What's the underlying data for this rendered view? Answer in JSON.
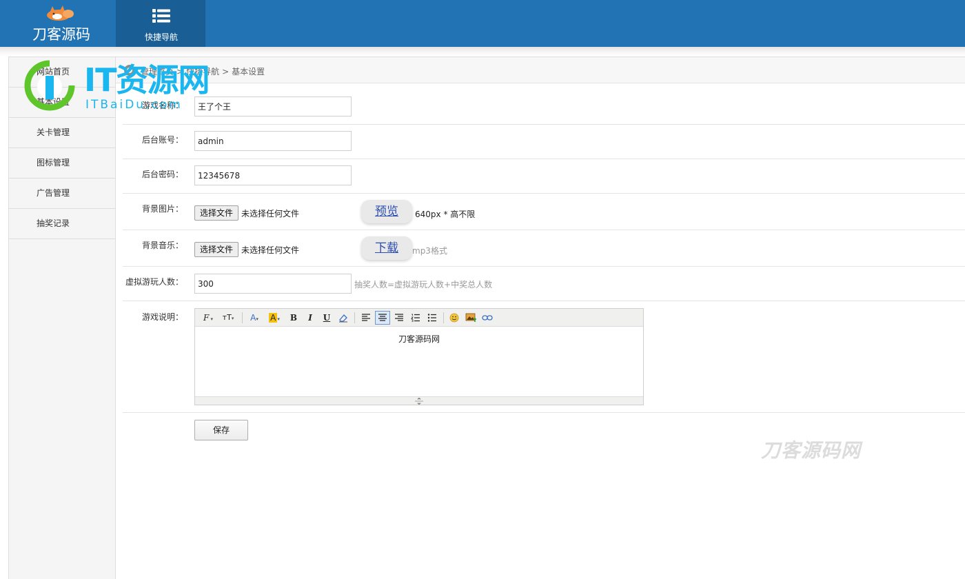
{
  "header": {
    "brand_name": "刀客源码",
    "quick_nav_label": "快捷导航",
    "brand_color": "#2173b3"
  },
  "sidebar": {
    "items": [
      {
        "label": "网站首页"
      },
      {
        "label": "基本设置"
      },
      {
        "label": "关卡管理"
      },
      {
        "label": "图标管理"
      },
      {
        "label": "广告管理"
      },
      {
        "label": "抽奖记录"
      }
    ]
  },
  "breadcrumb": {
    "items": [
      "管理首页",
      ">",
      "快捷导航",
      ">",
      "基本设置"
    ]
  },
  "form": {
    "game_name": {
      "label": "游戏名称：",
      "value": "王了个王"
    },
    "admin_account": {
      "label": "后台账号：",
      "value": "admin"
    },
    "admin_password": {
      "label": "后台密码：",
      "value": "12345678"
    },
    "background_image": {
      "label": "背景图片：",
      "button": "选择文件",
      "status": "未选择任何文件",
      "action": "预览",
      "hint": "640px * 高不限"
    },
    "background_music": {
      "label": "背景音乐：",
      "button": "选择文件",
      "status": "未选择任何文件",
      "action": "下载",
      "hint": "mp3格式"
    },
    "virtual_players": {
      "label": "虚拟游玩人数：",
      "value": "300",
      "hint": "抽奖人数=虚拟游玩人数+中奖总人数"
    },
    "game_description": {
      "label": "游戏说明：",
      "content": "刀客源码网",
      "toolbar": {
        "font_family": "F",
        "font_size": "тT",
        "font_color": "A",
        "highlight": "A",
        "bold": "B",
        "italic": "I",
        "underline": "U"
      }
    },
    "save_label": "保存"
  },
  "watermarks": {
    "it_title": "IT资源网",
    "it_subtitle": "ITBaiDu.com",
    "corner": "刀客源码网"
  }
}
